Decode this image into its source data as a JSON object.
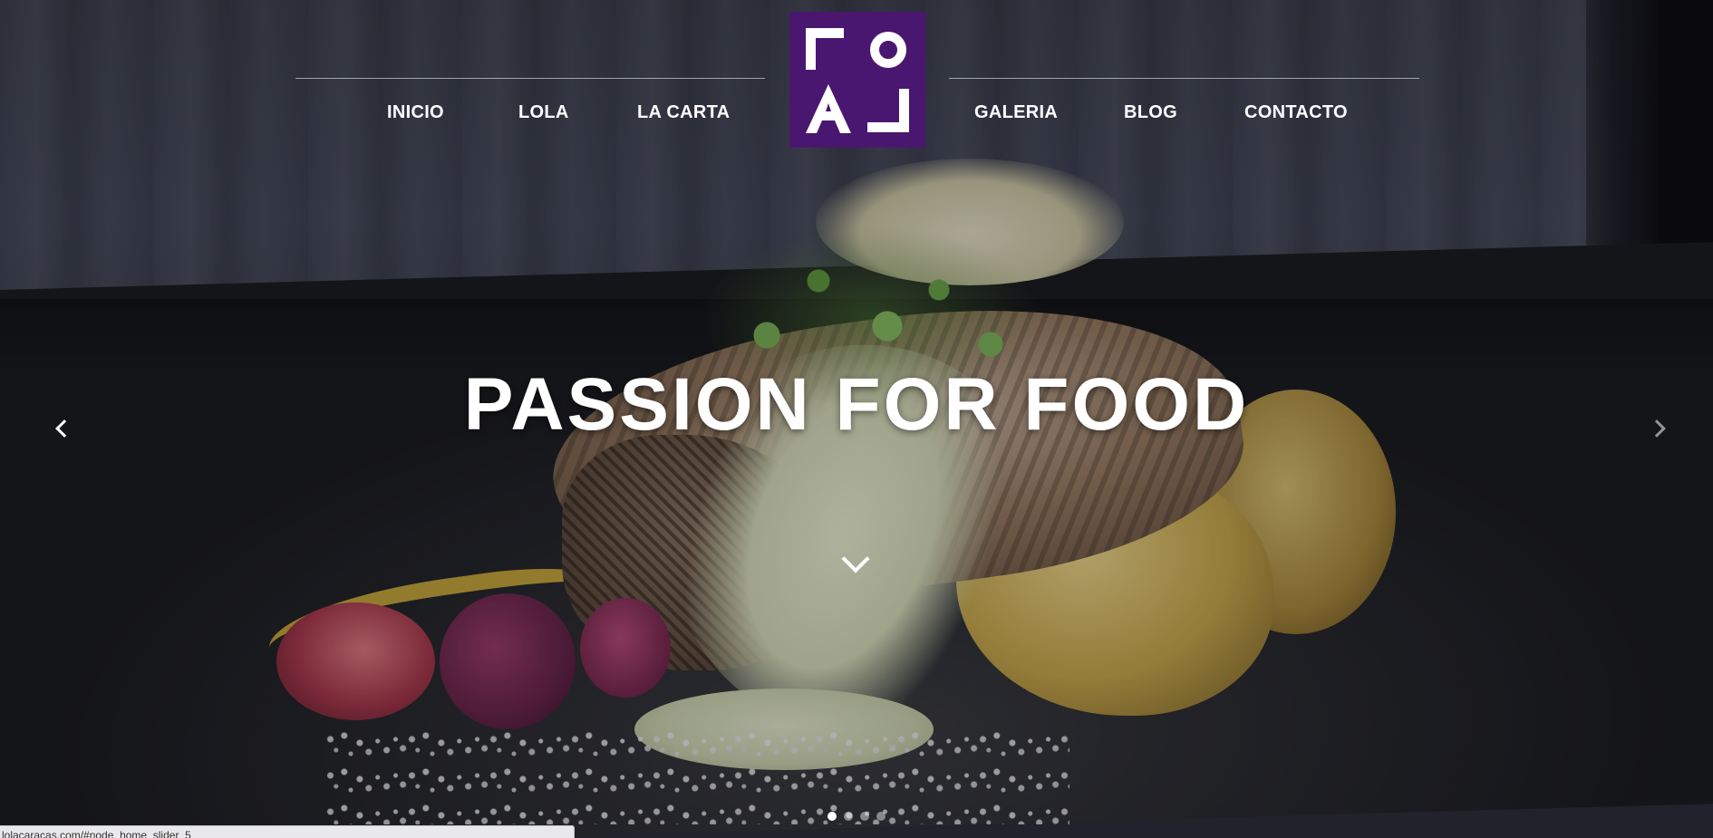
{
  "nav": {
    "left": [
      "INICIO",
      "LOLA",
      "LA CARTA"
    ],
    "right": [
      "GALERIA",
      "BLOG",
      "CONTACTO"
    ]
  },
  "logo": {
    "icon": "lola-logo-icon",
    "color": "#4a1770"
  },
  "hero": {
    "title": "PASSION FOR FOOD",
    "prev_icon": "chevron-left-icon",
    "next_icon": "chevron-right-icon",
    "scroll_icon": "chevron-down-icon"
  },
  "slider": {
    "slides": 4,
    "active": 1
  },
  "status_bar": {
    "url": "lolacaracas.com/#node_home_slider_5"
  },
  "colors": {
    "brand": "#4a1770",
    "text": "#ffffff"
  }
}
